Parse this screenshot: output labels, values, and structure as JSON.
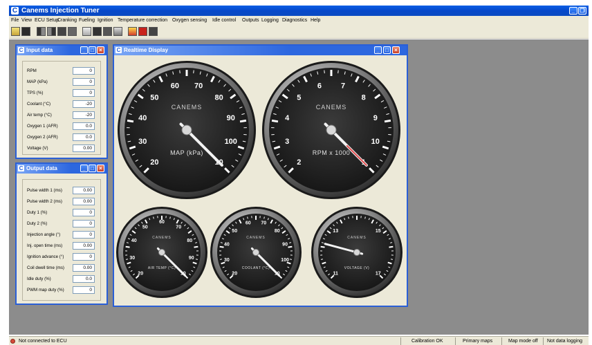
{
  "app": {
    "title": "Canems Injection Tuner",
    "icon": "canems-logo-icon"
  },
  "menu": [
    "File",
    "View",
    "ECU Setup",
    "Cranking",
    "Fueling",
    "Ignition",
    "Temperature correction",
    "Oxygen sensing",
    "Idle control",
    "Outputs",
    "Logging",
    "Diagnostics",
    "Help"
  ],
  "input_window": {
    "title": "Input data",
    "rows": [
      {
        "label": "RPM",
        "value": "0"
      },
      {
        "label": "MAP (kPa)",
        "value": "0"
      },
      {
        "label": "TPS (%)",
        "value": "0"
      },
      {
        "label": "Coolant (°C)",
        "value": "-20"
      },
      {
        "label": "Air temp (°C)",
        "value": "-20"
      },
      {
        "label": "Oxygen 1 (AFR)",
        "value": "0.0"
      },
      {
        "label": "Oxygen 2 (AFR)",
        "value": "0.0"
      },
      {
        "label": "Voltage (V)",
        "value": "0.00"
      }
    ]
  },
  "output_window": {
    "title": "Output data",
    "rows": [
      {
        "label": "Pulse width 1 (ms)",
        "value": "0.00"
      },
      {
        "label": "Pulse width 2 (ms)",
        "value": "0.00"
      },
      {
        "label": "Duty 1 (%)",
        "value": "0"
      },
      {
        "label": "Duty 2 (%)",
        "value": "0"
      },
      {
        "label": "Injection angle (°)",
        "value": "0"
      },
      {
        "label": "Inj. open time (ms)",
        "value": "0.00"
      },
      {
        "label": "Ignition advance (°)",
        "value": "0"
      },
      {
        "label": "Coil dwell time (ms)",
        "value": "0.00"
      },
      {
        "label": "Idle duty (%)",
        "value": "0.0"
      },
      {
        "label": "PWM map duty (%)",
        "value": "0"
      }
    ]
  },
  "realtime_window": {
    "title": "Realtime Display",
    "gauges": [
      {
        "name": "gauge-map",
        "brand": "CANEMS",
        "label": "MAP (kPa)",
        "ticks": [
          "20",
          "30",
          "40",
          "50",
          "60",
          "70",
          "80",
          "90",
          "100",
          "10"
        ],
        "needle_value": 0
      },
      {
        "name": "gauge-rpm",
        "brand": "CANEMS",
        "label": "RPM x 1000",
        "ticks": [
          "2",
          "3",
          "4",
          "5",
          "6",
          "7",
          "8",
          "9",
          "10",
          "1"
        ],
        "needle_value": 0
      },
      {
        "name": "gauge-air-temp",
        "brand": "CANEMS",
        "label": "AIR TEMP (°C)",
        "ticks": [
          "20",
          "30",
          "40",
          "50",
          "60",
          "70",
          "80",
          "90",
          "10"
        ],
        "needle_value": 0
      },
      {
        "name": "gauge-coolant",
        "brand": "CANEMS",
        "label": "COOLANT (°C)",
        "ticks": [
          "20",
          "30",
          "40",
          "50",
          "60",
          "70",
          "80",
          "90",
          "100",
          "10"
        ],
        "needle_value": 0
      },
      {
        "name": "gauge-voltage",
        "brand": "CANEMS",
        "label": "VOLTAGE (V)",
        "ticks": [
          "11",
          "13",
          "15",
          "17"
        ],
        "needle_value": 0
      }
    ]
  },
  "status": {
    "connection": "Not connected to ECU",
    "calibration": "Calibration OK",
    "maps": "Primary maps",
    "map_mode": "Map mode off",
    "logging": "Not data logging"
  }
}
